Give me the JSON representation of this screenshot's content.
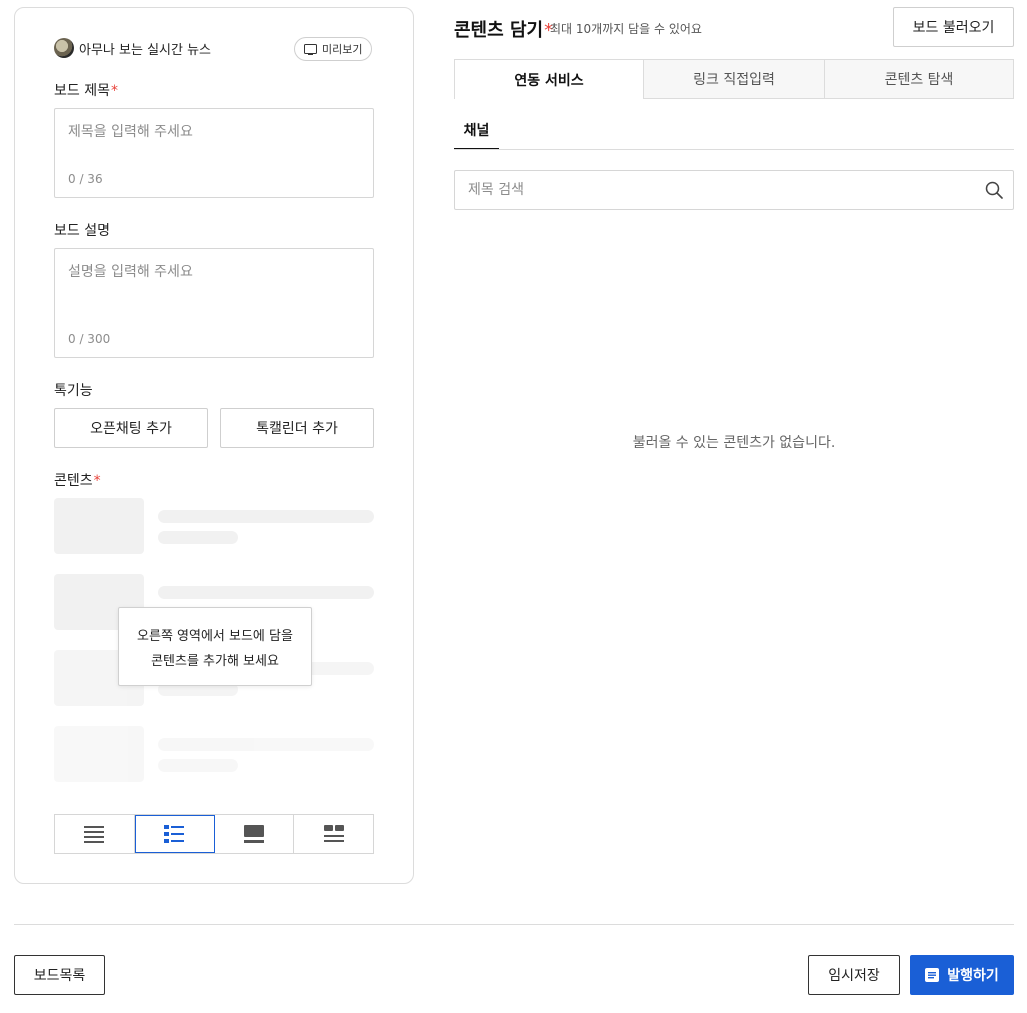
{
  "profile": {
    "name": "아무나 보는 실시간 뉴스",
    "preview_label": "미리보기"
  },
  "board_title": {
    "label": "보드 제목",
    "required_mark": "*",
    "placeholder": "제목을 입력해 주세요",
    "count": "0 / 36"
  },
  "board_desc": {
    "label": "보드 설명",
    "placeholder": "설명을 입력해 주세요",
    "count": "0 / 300"
  },
  "talk": {
    "label": "톡기능",
    "open_chat_label": "오픈채팅 추가",
    "calendar_label": "톡캘린더 추가"
  },
  "contents": {
    "label": "콘텐츠",
    "required_mark": "*",
    "tooltip_line1": "오른쪽 영역에서 보드에 담을",
    "tooltip_line2": "콘텐츠를 추가해 보세요"
  },
  "layout_options": {
    "selected_index": 1
  },
  "right": {
    "title": "콘텐츠 담기",
    "required_mark": "*",
    "subtitle": "최대 10개까지 담을 수 있어요",
    "load_label": "보드 불러오기",
    "tabs": [
      "연동 서비스",
      "링크 직접입력",
      "콘텐츠 탐색"
    ],
    "active_tab": 0,
    "subtab_label": "채널",
    "search_placeholder": "제목 검색",
    "empty_message": "불러올 수 있는 콘텐츠가 없습니다."
  },
  "footer": {
    "list_label": "보드목록",
    "draft_label": "임시저장",
    "publish_label": "발행하기"
  },
  "colors": {
    "accent": "#1a5fd6",
    "required": "#e8423a"
  }
}
